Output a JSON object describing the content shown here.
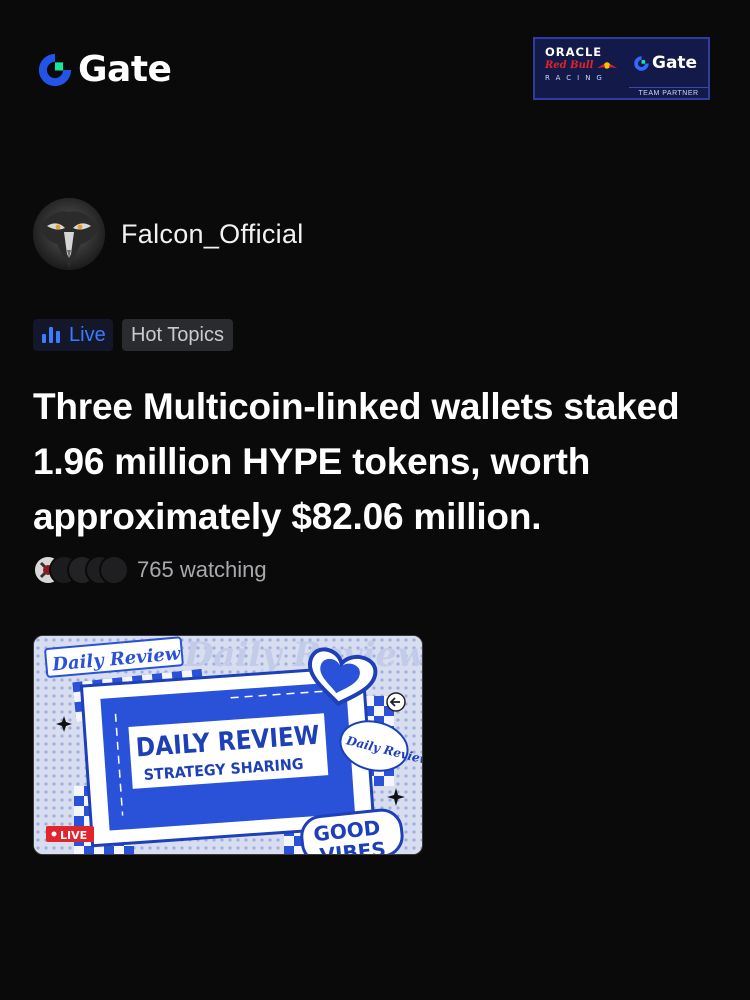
{
  "header": {
    "logo_text": "Gate",
    "brand_color": "#2354e6",
    "accent_color": "#17e6a1",
    "partner": {
      "oracle": "ORACLE",
      "redbull": "Red Bull",
      "racing": "RACING",
      "gate": "Gate",
      "team": "TEAM PARTNER"
    }
  },
  "author": {
    "name": "Falcon_Official",
    "avatar_icon": "falcon-avatar"
  },
  "tags": {
    "live": "Live",
    "hot": "Hot Topics",
    "live_color": "#3a7bff"
  },
  "post": {
    "headline": "Three Multicoin-linked wallets staked 1.96 million HYPE tokens, worth approximately $82.06 million."
  },
  "watching": {
    "text": "765 watching"
  },
  "thumbnail": {
    "corner_label": "Daily Review",
    "title": "DAILY REVIEW",
    "subtitle": "STRATEGY SHARING",
    "sticker": "Daily Review",
    "badge_top": "GOOD",
    "badge_bottom": "VIBES",
    "live_badge": "LIVE",
    "bg_text": "Daily Review"
  }
}
